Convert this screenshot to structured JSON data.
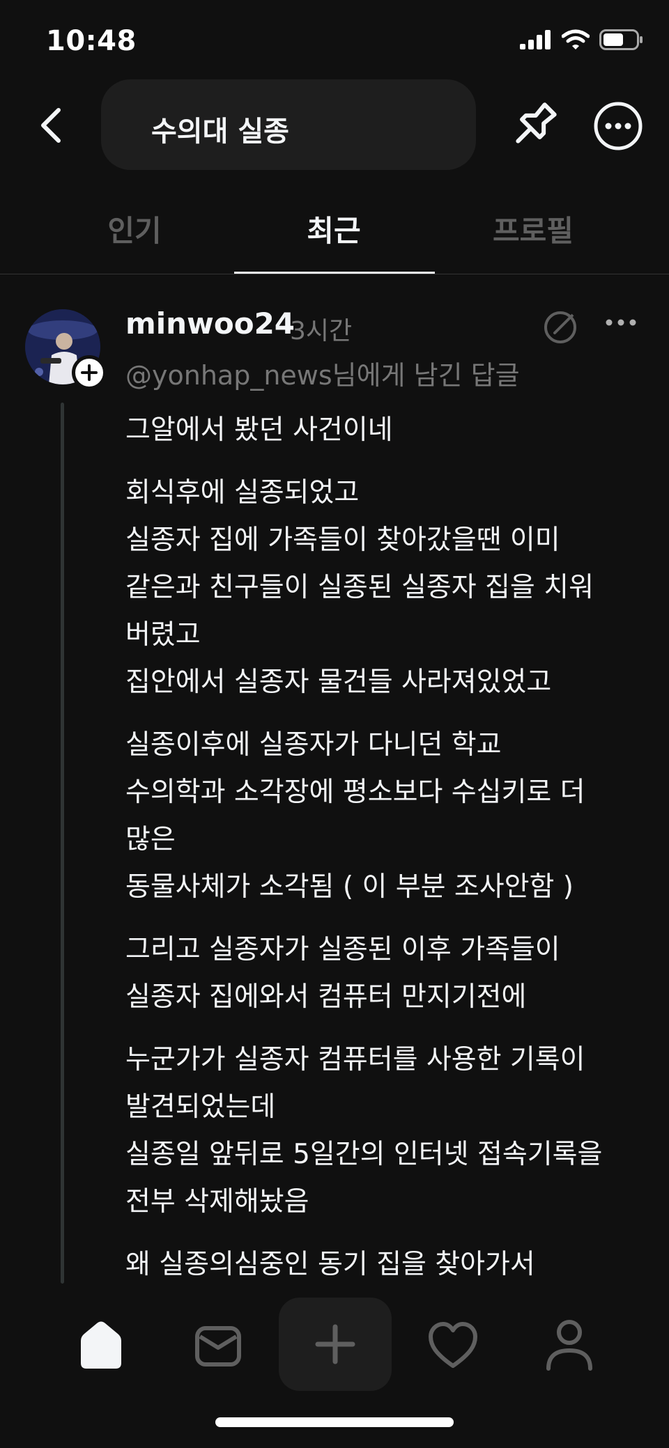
{
  "status_bar": {
    "time": "10:48"
  },
  "header": {
    "search_query": "수의대 실종"
  },
  "tabs": [
    {
      "label": "인기",
      "active": false
    },
    {
      "label": "최근",
      "active": true
    },
    {
      "label": "프로필",
      "active": false
    }
  ],
  "post": {
    "username": "minwoo24",
    "time_ago": "3시간",
    "reply_to": "@yonhap_news님에게 남긴 답글",
    "paragraphs": [
      [
        "그알에서 봤던 사건이네"
      ],
      [
        "회식후에 실종되었고",
        "실종자 집에 가족들이 찾아갔을땐 이미",
        "같은과 친구들이 실종된 실종자 집을 치워",
        "버렸고",
        "집안에서 실종자 물건들 사라져있었고"
      ],
      [
        "실종이후에 실종자가 다니던 학교",
        "수의학과 소각장에 평소보다 수십키로 더",
        "많은",
        "동물사체가 소각됨 ( 이 부분 조사안함 )"
      ],
      [
        "그리고 실종자가 실종된 이후 가족들이",
        "실종자 집에와서 컴퓨터 만지기전에"
      ],
      [
        "누군가가 실종자 컴퓨터를 사용한 기록이",
        "발견되었는데",
        "실종일 앞뒤로 5일간의 인터넷 접속기록을",
        "전부 삭제해놨음"
      ],
      [
        "왜 실종의심중인 동기 집을 찾아가서"
      ]
    ]
  },
  "colors": {
    "background": "#101010",
    "text_primary": "#f3f5f7",
    "text_secondary": "#777777",
    "pill": "#1e1e1e"
  },
  "icons": {
    "back": "chevron-left-icon",
    "pin": "pin-icon",
    "more": "more-circle-icon",
    "edit": "edit-icon",
    "home": "home-icon",
    "inbox": "inbox-icon",
    "compose": "plus-icon",
    "activity": "heart-icon",
    "profile": "profile-icon"
  }
}
